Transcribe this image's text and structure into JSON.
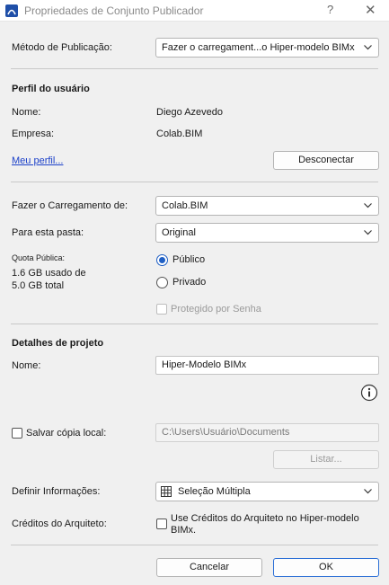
{
  "window": {
    "title": "Propriedades de Conjunto Publicador",
    "help_glyph": "?",
    "close_glyph": "✕"
  },
  "publish": {
    "method_label": "Método de Publicação:",
    "method_value": "Fazer o carregament...o Hiper-modelo BIMx"
  },
  "profile": {
    "heading": "Perfil do usuário",
    "name_label": "Nome:",
    "name_value": "Diego Azevedo",
    "company_label": "Empresa:",
    "company_value": "Colab.BIM",
    "my_profile_link": "Meu perfil...",
    "disconnect_label": "Desconectar"
  },
  "upload": {
    "from_label": "Fazer o Carregamento de:",
    "from_value": "Colab.BIM",
    "folder_label": "Para esta pasta:",
    "folder_value": "Original",
    "quota_label": "Quota Pública:",
    "quota_used": "1.6 GB usado de",
    "quota_total": "5.0 GB total",
    "public_label": "Público",
    "private_label": "Privado",
    "password_label": "Protegido por Senha"
  },
  "project": {
    "heading": "Detalhes de projeto",
    "name_label": "Nome:",
    "name_value": "Hiper-Modelo BIMx",
    "info_icon": "i",
    "save_local_label": "Salvar cópia local:",
    "save_local_path": "C:\\Users\\Usuário\\Documents",
    "list_label": "Listar..."
  },
  "define": {
    "label": "Definir Informações:",
    "value": "Seleção Múltipla"
  },
  "credits": {
    "label": "Créditos do Arquiteto:",
    "checkbox_label_line1": "Use Créditos do Arquiteto no Hiper-modelo",
    "checkbox_label_line2": "BIMx."
  },
  "footer": {
    "cancel_label": "Cancelar",
    "ok_label": "OK"
  },
  "colors": {
    "accent": "#1f5fc4",
    "link": "#1a3fc9",
    "background": "#f0f0f0"
  }
}
